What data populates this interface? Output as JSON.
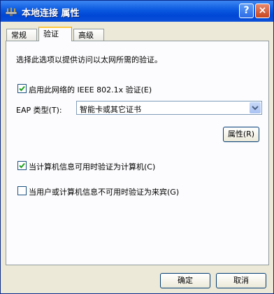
{
  "window": {
    "title": "本地连接 属性",
    "help_label": "?",
    "close_label": "×"
  },
  "tabs": [
    {
      "label": "常规",
      "active": false
    },
    {
      "label": "验证",
      "active": true
    },
    {
      "label": "高级",
      "active": false
    }
  ],
  "panel": {
    "description": "选择此选项以提供访问以太网所需的验证。",
    "enable_auth": {
      "label": "启用此网络的 IEEE 802.1x 验证(E)",
      "checked": true
    },
    "eap": {
      "label": "EAP 类型(T):",
      "selected": "智能卡或其它证书"
    },
    "properties_button": "属性(R)",
    "auth_as_computer": {
      "label": "当计算机信息可用时验证为计算机(C)",
      "checked": true
    },
    "auth_as_guest": {
      "label": "当用户或计算机信息不可用时验证为来宾(G)",
      "checked": false
    }
  },
  "footer": {
    "ok_label": "确定",
    "cancel_label": "取消"
  },
  "colors": {
    "titlebar": "#0a58e0",
    "tab_highlight": "#ffc83c",
    "dialog_bg": "#ece9d8"
  }
}
